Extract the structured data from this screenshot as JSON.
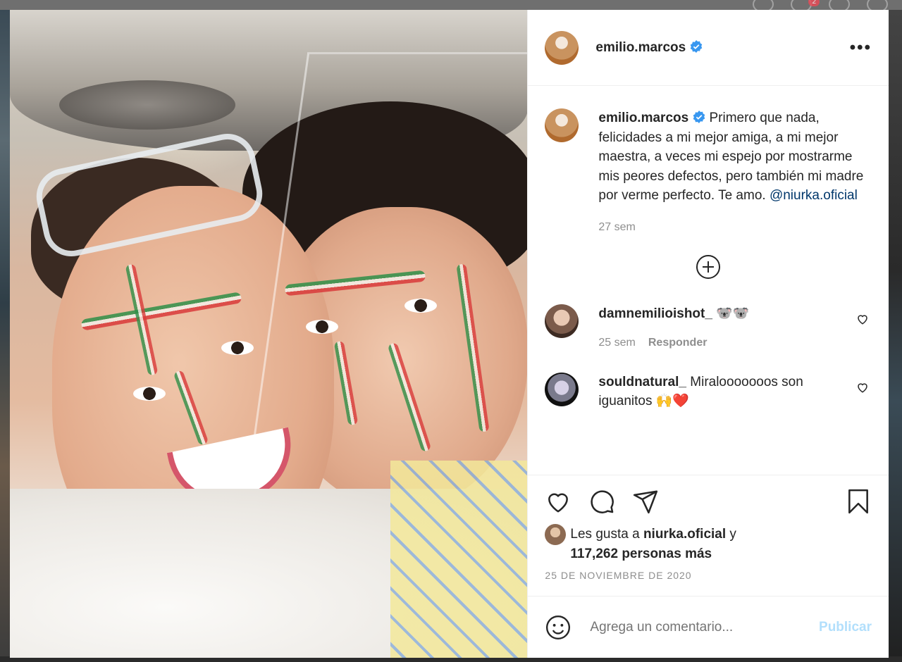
{
  "post": {
    "username": "emilio.marcos",
    "caption": "Primero que nada, felicidades a mi mejor amiga, a mi mejor maestra, a veces mi espejo por mostrarme mis peores defectos, pero también mi madre por verme perfecto. Te amo.",
    "mention": "@niurka.oficial",
    "caption_time": "27 sem"
  },
  "comments": [
    {
      "username": "damnemilioishot_",
      "text": "🐨🐨",
      "time": "25 sem",
      "reply_label": "Responder"
    },
    {
      "username": "souldnatural_",
      "text": "Miralooooooos son iguanitos 🙌❤️"
    }
  ],
  "likes": {
    "prefix": "Les gusta a",
    "liker": "niurka.oficial",
    "conjunction": "y",
    "count_text": "117,262 personas más"
  },
  "date": "25 DE NOVIEMBRE DE 2020",
  "composer": {
    "placeholder": "Agrega un comentario...",
    "publish_label": "Publicar"
  },
  "background": {
    "notification_count": "2"
  },
  "colors": {
    "verified": "#3897f0",
    "link": "#00376b",
    "publish_disabled": "#b2dffc",
    "secondary_text": "#8e8e8e"
  },
  "icons": [
    "more-options-icon",
    "verified-badge-icon",
    "load-more-plus-icon",
    "heart-icon",
    "comment-icon",
    "share-icon",
    "bookmark-icon",
    "emoji-icon"
  ]
}
